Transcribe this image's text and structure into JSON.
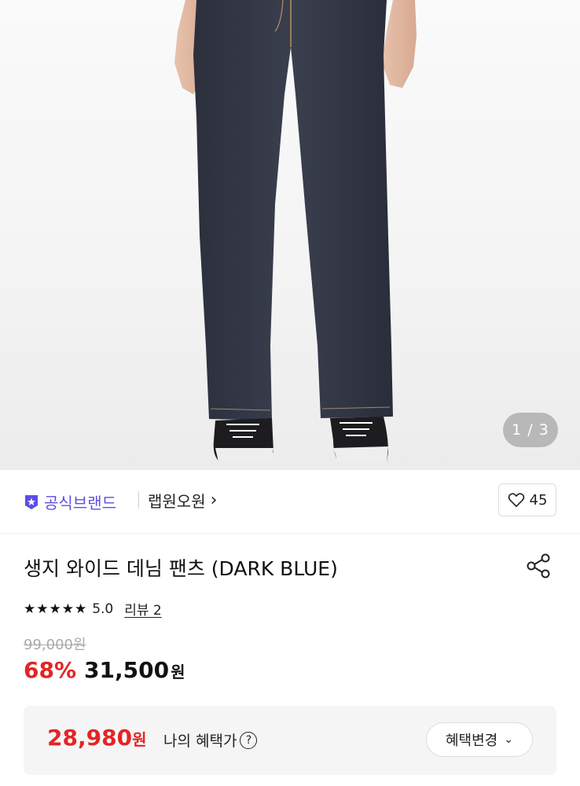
{
  "gallery": {
    "image_alt": "jeans-photo",
    "pager": "1 / 3"
  },
  "brand": {
    "official_label": "공식브랜드",
    "name": "랩원오원",
    "chevron": "›",
    "like_count": "45",
    "accent_color": "#5b4ee6"
  },
  "product": {
    "title": "생지 와이드 데님 팬츠 (DARK BLUE)",
    "stars": "★★★★★",
    "rating": "5.0",
    "review_label": "리뷰 2"
  },
  "price": {
    "original": "99,000원",
    "discount": "68%",
    "sale": "31,500",
    "unit": "원",
    "discount_color": "#e32525"
  },
  "benefit": {
    "price": "28,980",
    "unit": "원",
    "label": "나의 혜택가",
    "help": "?",
    "change_button": "혜택변경",
    "chevron": "⌄"
  },
  "icons": [
    "official-badge-icon",
    "heart-icon",
    "share-icon",
    "help-icon",
    "chevron-down-icon"
  ]
}
